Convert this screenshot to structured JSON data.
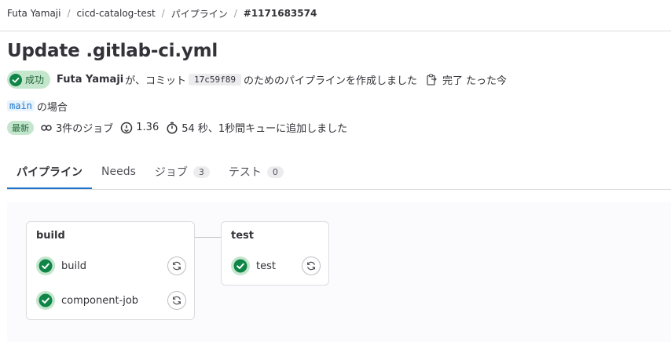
{
  "breadcrumb": {
    "items": [
      "Futa Yamaji",
      "cicd-catalog-test",
      "パイプライン"
    ],
    "current": "#1171683574",
    "separator": "/"
  },
  "title": "Update .gitlab-ci.yml",
  "meta": {
    "status": "成功",
    "author": "Futa Yamaji",
    "text_ga_commit": "が、コミット",
    "commit_sha": "17c59f89",
    "text_pipeline_created": "のためのパイプラインを作成しました",
    "completed": "完了",
    "time_ago": "たった今"
  },
  "ref": {
    "branch": "main",
    "suffix": "の場合"
  },
  "info": {
    "latest": "最新",
    "jobs": "3件のジョブ",
    "duration": "1.36",
    "queued": "54 秒、1秒間キューに追加しました"
  },
  "tabs": [
    {
      "label": "パイプライン",
      "count": null
    },
    {
      "label": "Needs",
      "count": null
    },
    {
      "label": "ジョブ",
      "count": "3"
    },
    {
      "label": "テスト",
      "count": "0"
    }
  ],
  "stages": {
    "build": {
      "title": "build",
      "jobs": [
        {
          "name": "build"
        },
        {
          "name": "component-job"
        }
      ]
    },
    "test": {
      "title": "test",
      "jobs": [
        {
          "name": "test"
        }
      ]
    }
  },
  "colors": {
    "success": "#108548",
    "success_bg": "#c3e6cd",
    "link": "#1f75cb"
  },
  "icons": {
    "status": "status-success-icon",
    "copy": "clipboard-icon",
    "jobs": "pipeline-icon",
    "duration": "timer-icon",
    "queued": "stopwatch-icon",
    "retry": "retry-icon"
  }
}
